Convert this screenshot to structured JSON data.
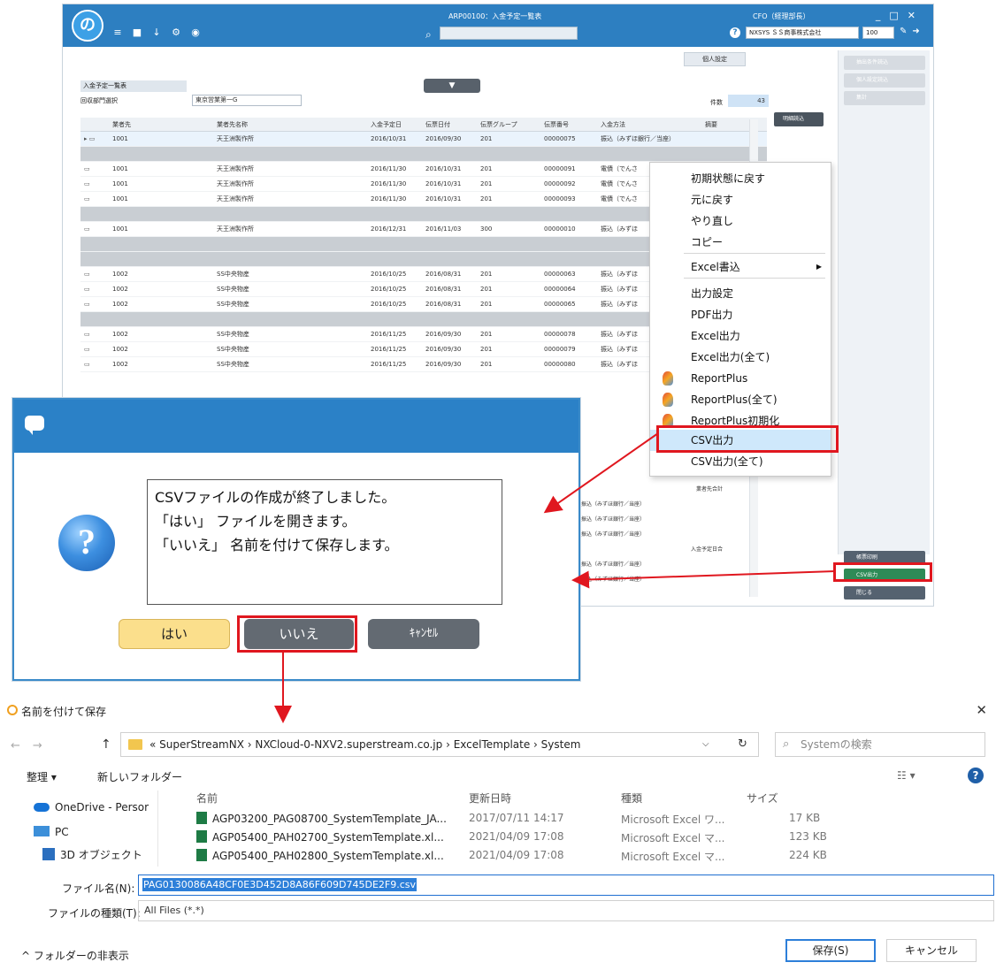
{
  "app": {
    "title": "ARP00100：入金予定一覧表",
    "user": "CFO（経理部長）",
    "company": "NXSYS ＳＳ商事株式会社",
    "scale": "100",
    "personal_settings": "個人設定",
    "panel_title": "入金予定一覧表",
    "dept_label": "回収部門選択",
    "dept_value": "東京営業第一G",
    "count_label": "件数",
    "count_value": "43",
    "detail_button": "明細読込",
    "side_buttons": [
      "抽出条件読込",
      "個人設定読込",
      "集計"
    ],
    "side_bottom_buttons": [
      "帳票印刷",
      "CSV出力",
      "閉じる"
    ]
  },
  "grid": {
    "columns": [
      "",
      "業者先",
      "業者先名称",
      "入金予定日",
      "伝票日付",
      "伝票グループ",
      "伝票番号",
      "入金方法",
      "摘要"
    ],
    "rows": [
      {
        "gray": false,
        "sel": true,
        "code": "1001",
        "name": "天王洲製作所",
        "date": "2016/10/31",
        "slip": "2016/09/30",
        "grp": "201",
        "no": "00000075",
        "method": "振込（みずほ銀行／当座）",
        "memo": ""
      },
      {
        "gray": true,
        "sel": false,
        "code": "",
        "name": "",
        "date": "",
        "slip": "",
        "grp": "",
        "no": "",
        "method": "",
        "memo": ""
      },
      {
        "gray": false,
        "sel": false,
        "code": "1001",
        "name": "天王洲製作所",
        "date": "2016/11/30",
        "slip": "2016/10/31",
        "grp": "201",
        "no": "00000091",
        "method": "電債（でんさ",
        "memo": ""
      },
      {
        "gray": false,
        "sel": false,
        "code": "1001",
        "name": "天王洲製作所",
        "date": "2016/11/30",
        "slip": "2016/10/31",
        "grp": "201",
        "no": "00000092",
        "method": "電債（でんさ",
        "memo": ""
      },
      {
        "gray": false,
        "sel": false,
        "code": "1001",
        "name": "天王洲製作所",
        "date": "2016/11/30",
        "slip": "2016/10/31",
        "grp": "201",
        "no": "00000093",
        "method": "電債（でんさ",
        "memo": ""
      },
      {
        "gray": true,
        "sel": false,
        "code": "",
        "name": "",
        "date": "",
        "slip": "",
        "grp": "",
        "no": "",
        "method": "",
        "memo": ""
      },
      {
        "gray": false,
        "sel": false,
        "code": "1001",
        "name": "天王洲製作所",
        "date": "2016/12/31",
        "slip": "2016/11/03",
        "grp": "300",
        "no": "00000010",
        "method": "振込（みずほ",
        "memo": ""
      },
      {
        "gray": true,
        "sel": false,
        "code": "",
        "name": "",
        "date": "",
        "slip": "",
        "grp": "",
        "no": "",
        "method": "",
        "memo": ""
      },
      {
        "gray": true,
        "sel": false,
        "code": "",
        "name": "",
        "date": "",
        "slip": "",
        "grp": "",
        "no": "",
        "method": "",
        "memo": ""
      },
      {
        "gray": false,
        "sel": false,
        "code": "1002",
        "name": "SS中央物産",
        "date": "2016/10/25",
        "slip": "2016/08/31",
        "grp": "201",
        "no": "00000063",
        "method": "振込（みずほ",
        "memo": ""
      },
      {
        "gray": false,
        "sel": false,
        "code": "1002",
        "name": "SS中央物産",
        "date": "2016/10/25",
        "slip": "2016/08/31",
        "grp": "201",
        "no": "00000064",
        "method": "振込（みずほ",
        "memo": ""
      },
      {
        "gray": false,
        "sel": false,
        "code": "1002",
        "name": "SS中央物産",
        "date": "2016/10/25",
        "slip": "2016/08/31",
        "grp": "201",
        "no": "00000065",
        "method": "振込（みずほ",
        "memo": ""
      },
      {
        "gray": true,
        "sel": false,
        "code": "",
        "name": "",
        "date": "",
        "slip": "",
        "grp": "",
        "no": "",
        "method": "",
        "memo": ""
      },
      {
        "gray": false,
        "sel": false,
        "code": "1002",
        "name": "SS中央物産",
        "date": "2016/11/25",
        "slip": "2016/09/30",
        "grp": "201",
        "no": "00000078",
        "method": "振込（みずほ",
        "memo": ""
      },
      {
        "gray": false,
        "sel": false,
        "code": "1002",
        "name": "SS中央物産",
        "date": "2016/11/25",
        "slip": "2016/09/30",
        "grp": "201",
        "no": "00000079",
        "method": "振込（みずほ",
        "memo": ""
      },
      {
        "gray": false,
        "sel": false,
        "code": "1002",
        "name": "SS中央物産",
        "date": "2016/11/25",
        "slip": "2016/09/30",
        "grp": "201",
        "no": "00000080",
        "method": "振込（みずほ",
        "memo": ""
      }
    ],
    "lower_right": [
      {
        "grp": true,
        "text": "業者先合計"
      },
      {
        "grp": false,
        "text": "振込（みずほ銀行／当座）"
      },
      {
        "grp": false,
        "text": "振込（みずほ銀行／当座）"
      },
      {
        "grp": false,
        "text": "振込（みずほ銀行／当座）"
      },
      {
        "grp": true,
        "text": "入金予定日合"
      },
      {
        "grp": false,
        "text": "振込（みずほ銀行／当座）"
      },
      {
        "grp": false,
        "text": "振込（みずほ銀行／当座）"
      }
    ]
  },
  "context_menu": {
    "items": [
      {
        "label": "初期状態に戻す",
        "icon": false,
        "arrow": false
      },
      {
        "label": "元に戻す",
        "icon": false,
        "arrow": false
      },
      {
        "label": "やり直し",
        "icon": false,
        "arrow": false
      },
      {
        "label": "コピー",
        "icon": false,
        "arrow": false
      },
      {
        "label": "Excel書込",
        "icon": false,
        "arrow": true
      },
      {
        "label": "出力設定",
        "icon": false,
        "arrow": false
      },
      {
        "label": "PDF出力",
        "icon": false,
        "arrow": false
      },
      {
        "label": "Excel出力",
        "icon": false,
        "arrow": false
      },
      {
        "label": "Excel出力(全て)",
        "icon": false,
        "arrow": false
      },
      {
        "label": "ReportPlus",
        "icon": true,
        "arrow": false
      },
      {
        "label": "ReportPlus(全て)",
        "icon": true,
        "arrow": false
      },
      {
        "label": "ReportPlus初期化",
        "icon": true,
        "arrow": false
      },
      {
        "label": "CSV出力",
        "icon": false,
        "arrow": false,
        "highlight": true
      },
      {
        "label": "CSV出力(全て)",
        "icon": false,
        "arrow": false
      }
    ]
  },
  "dialog": {
    "message_lines": [
      "CSVファイルの作成が終了しました。",
      "「はい」 ファイルを開きます。",
      "「いいえ」 名前を付けて保存します。"
    ],
    "yes": "はい",
    "no": "いいえ",
    "cancel": "ｷｬﾝｾﾙ"
  },
  "save_dialog": {
    "title": "名前を付けて保存",
    "address": "«  SuperStreamNX  ›  NXCloud-0-NXV2.superstream.co.jp  ›  ExcelTemplate  ›  System",
    "search_placeholder": "Systemの検索",
    "organize": "整理 ▾",
    "new_folder": "新しいフォルダー",
    "nav": [
      "OneDrive - Persor",
      "PC",
      "3D オブジェクト"
    ],
    "headers": [
      "名前",
      "更新日時",
      "種類",
      "サイズ"
    ],
    "files": [
      {
        "name": "AGP03200_PAG08700_SystemTemplate_JA...",
        "date": "2017/07/11 14:17",
        "type": "Microsoft Excel ワ...",
        "size": "17 KB"
      },
      {
        "name": "AGP05400_PAH02700_SystemTemplate.xl...",
        "date": "2021/04/09 17:08",
        "type": "Microsoft Excel マ...",
        "size": "123 KB"
      },
      {
        "name": "AGP05400_PAH02800_SystemTemplate.xl...",
        "date": "2021/04/09 17:08",
        "type": "Microsoft Excel マ...",
        "size": "224 KB"
      }
    ],
    "filename_label": "ファイル名(N):",
    "filename_value": "PAG0130086A48CF0E3D452D8A86F609D745DE2F9.csv",
    "filetype_label": "ファイルの種類(T):",
    "filetype_value": "All Files (*.*)",
    "hide_folders": "^  フォルダーの非表示",
    "save": "保存(S)",
    "cancel": "キャンセル"
  },
  "colors": {
    "titlebar": "#2d7fc1",
    "highlight_box": "#e0171f",
    "yes_button": "#fbdf8c",
    "gray_button": "#636a72"
  }
}
